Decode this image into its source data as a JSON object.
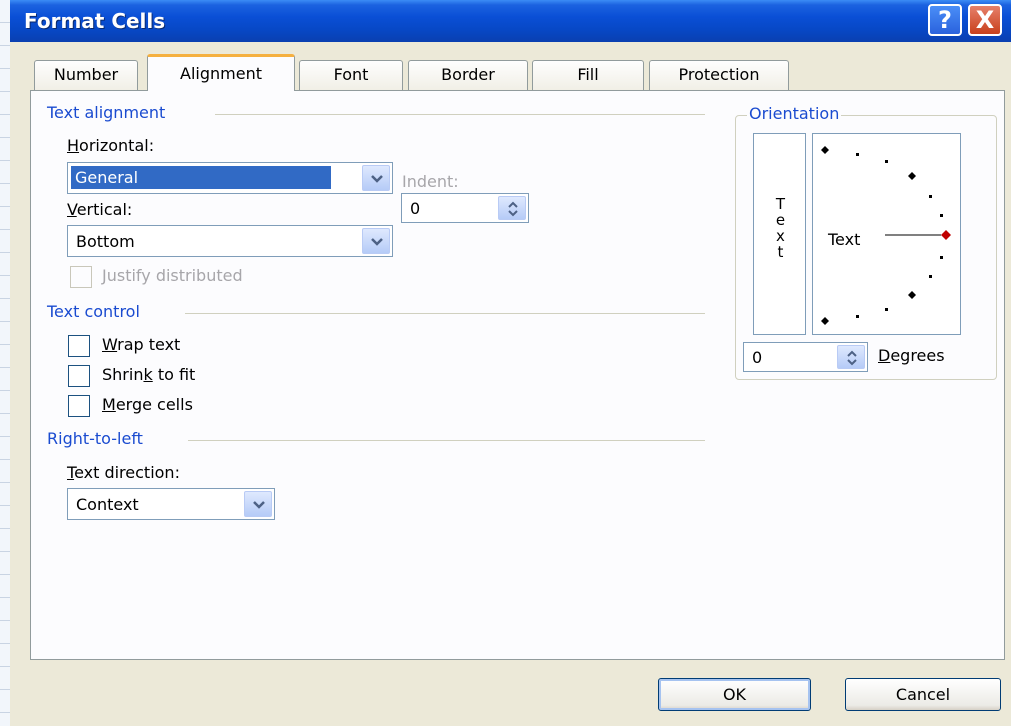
{
  "window": {
    "title": "Format Cells",
    "help_label": "?",
    "close_label": "X"
  },
  "tabs": [
    {
      "label": "Number",
      "active": false
    },
    {
      "label": "Alignment",
      "active": true
    },
    {
      "label": "Font",
      "active": false
    },
    {
      "label": "Border",
      "active": false
    },
    {
      "label": "Fill",
      "active": false
    },
    {
      "label": "Protection",
      "active": false
    }
  ],
  "text_alignment": {
    "section_label": "Text alignment",
    "horizontal": {
      "label_mnemonic": "H",
      "label_rest": "orizontal:",
      "value": "General"
    },
    "vertical": {
      "label_mnemonic": "V",
      "label_rest": "ertical:",
      "value": "Bottom"
    },
    "indent": {
      "label": "Indent:",
      "value": "0"
    },
    "justify_distributed": {
      "label": "Justify distributed",
      "checked": false,
      "enabled": false
    }
  },
  "text_control": {
    "section_label": "Text control",
    "wrap_text": {
      "mnemonic": "W",
      "rest": "rap text",
      "checked": false
    },
    "shrink_to_fit": {
      "before": "Shrin",
      "mnemonic": "k",
      "after": " to fit",
      "checked": false
    },
    "merge_cells": {
      "mnemonic": "M",
      "rest": "erge cells",
      "checked": false
    }
  },
  "right_to_left": {
    "section_label": "Right-to-left",
    "text_direction": {
      "label_mnemonic": "T",
      "label_rest": "ext direction:",
      "value": "Context"
    }
  },
  "orientation": {
    "section_label": "Orientation",
    "vertical_text": "T\ne\nx\nt",
    "dial_text": "Text",
    "degrees_value": "0",
    "degrees_mnemonic": "D",
    "degrees_rest": "egrees",
    "angle_degrees": 0,
    "indicator_color": "#c00000"
  },
  "buttons": {
    "ok": "OK",
    "cancel": "Cancel"
  },
  "colors": {
    "title_bar": "#0a4fd6",
    "section_label": "#1a4bd0",
    "selection": "#316ac5",
    "active_tab_highlight": "#f5b040"
  },
  "icons": {
    "dropdown": "chevron-down-icon",
    "spinner": "spin-up-down-icon",
    "help": "help-icon",
    "close": "close-icon"
  }
}
